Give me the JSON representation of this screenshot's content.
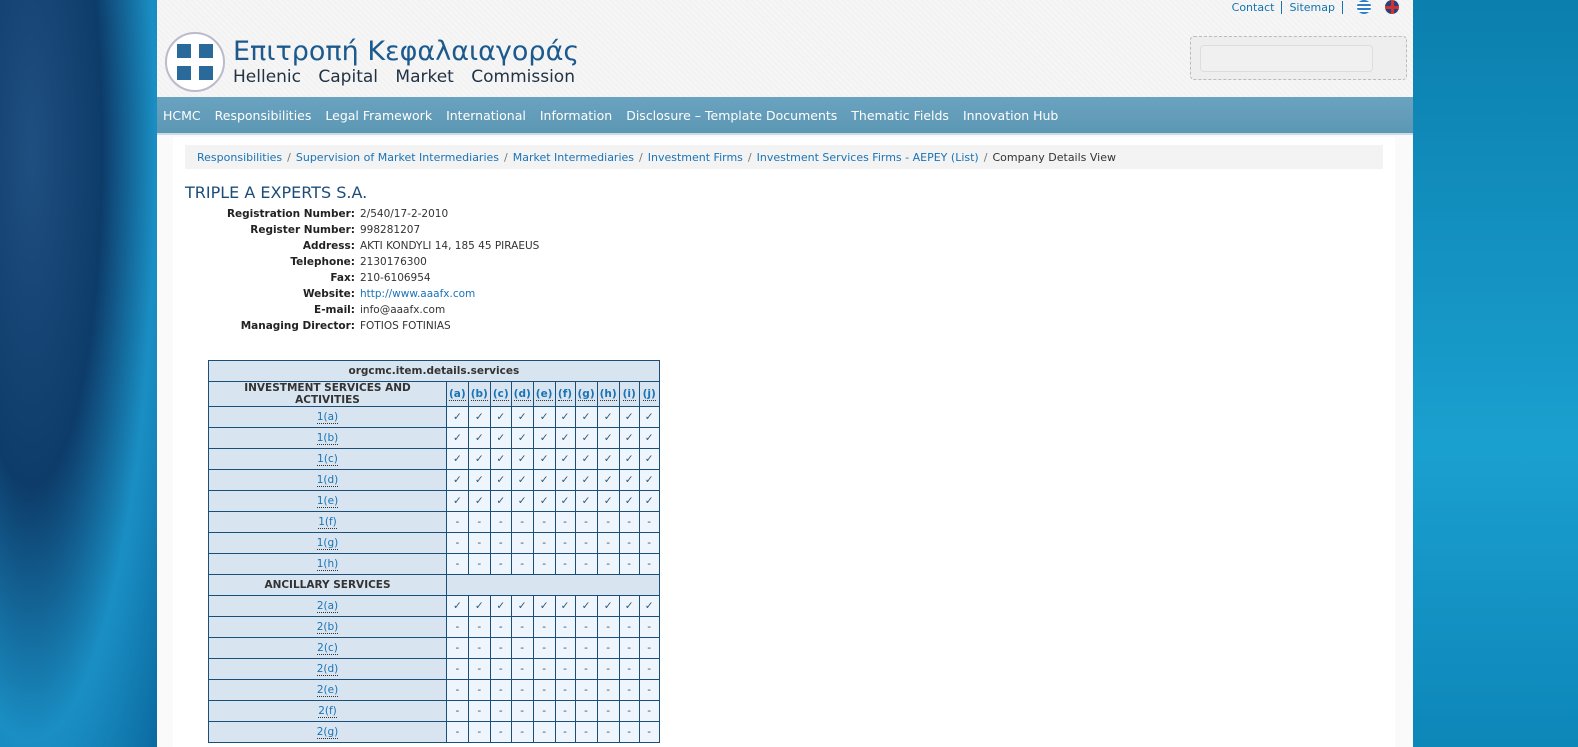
{
  "toplinks": {
    "contact": "Contact",
    "sitemap": "Sitemap"
  },
  "logo": {
    "greek": "Επιτροπή Κεφαλαιαγοράς",
    "english": "Hellenic Capital Market Commission"
  },
  "search": {
    "value": "",
    "placeholder": ""
  },
  "nav": [
    "HCMC",
    "Responsibilities",
    "Legal Framework",
    "International",
    "Information",
    "Disclosure – Template Documents",
    "Thematic Fields",
    "Innovation Hub"
  ],
  "breadcrumb": [
    "Responsibilities",
    "Supervision of Market Intermediaries",
    "Market Intermediaries",
    "Investment Firms",
    "Investment Services Firms - AEPEY (List)"
  ],
  "breadcrumb_current": "Company Details View",
  "company": {
    "name": "TRIPLE A EXPERTS S.A.",
    "fields": [
      {
        "label": "Registration Number:",
        "value": "2/540/17-2-2010"
      },
      {
        "label": "Register Number:",
        "value": "998281207"
      },
      {
        "label": "Address:",
        "value": "AKTI KONDYLI 14, 185 45 PIRAEUS"
      },
      {
        "label": "Telephone:",
        "value": "2130176300"
      },
      {
        "label": "Fax:",
        "value": "210-6106954"
      },
      {
        "label": "Website:",
        "value": "http://www.aaafx.com",
        "link": true
      },
      {
        "label": "E-mail:",
        "value": "info@aaafx.com"
      },
      {
        "label": "Managing Director:",
        "value": "FOTIOS FOTINIAS"
      }
    ]
  },
  "services": {
    "title": "orgcmc.item.details.services",
    "section1": "INVESTMENT SERVICES AND ACTIVITIES",
    "columns": [
      "(a)",
      "(b)",
      "(c)",
      "(d)",
      "(e)",
      "(f)",
      "(g)",
      "(h)",
      "(i)",
      "(j)"
    ],
    "rows1": [
      {
        "k": "1(a)",
        "v": "✓"
      },
      {
        "k": "1(b)",
        "v": "✓"
      },
      {
        "k": "1(c)",
        "v": "✓"
      },
      {
        "k": "1(d)",
        "v": "✓"
      },
      {
        "k": "1(e)",
        "v": "✓"
      },
      {
        "k": "1(f)",
        "v": "-"
      },
      {
        "k": "1(g)",
        "v": "-"
      },
      {
        "k": "1(h)",
        "v": "-"
      }
    ],
    "section2": "ANCILLARY SERVICES",
    "rows2": [
      {
        "k": "2(a)",
        "v": "✓"
      },
      {
        "k": "2(b)",
        "v": "-"
      },
      {
        "k": "2(c)",
        "v": "-"
      },
      {
        "k": "2(d)",
        "v": "-"
      },
      {
        "k": "2(e)",
        "v": "-"
      },
      {
        "k": "2(f)",
        "v": "-"
      },
      {
        "k": "2(g)",
        "v": "-"
      }
    ]
  }
}
